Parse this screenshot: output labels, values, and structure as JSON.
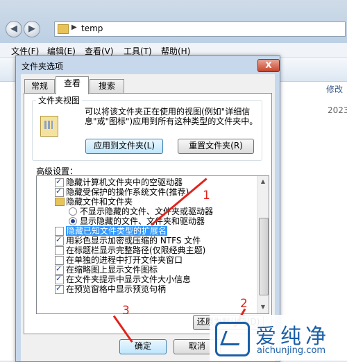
{
  "explorer": {
    "path_label": "temp",
    "menu": [
      "文件(F)",
      "编辑(E)",
      "查看(V)",
      "工具(T)",
      "帮助(H)"
    ],
    "column_header": "修改",
    "column_value": "2023"
  },
  "dialog": {
    "title": "文件夹选项",
    "close_label": "X",
    "tabs": [
      "常规",
      "查看",
      "搜索"
    ],
    "active_tab": "查看",
    "folder_views": {
      "group_label": "文件夹视图",
      "description": "可以将该文件夹正在使用的视图(例如\"详细信息\"或\"图标\")应用到所有这种类型的文件夹中。",
      "apply_button": "应用到文件夹(L)",
      "reset_button": "重置文件夹(R)"
    },
    "advanced": {
      "label": "高级设置：",
      "items": [
        {
          "type": "checkbox",
          "checked": true,
          "label": "隐藏计算机文件夹中的空驱动器"
        },
        {
          "type": "checkbox",
          "checked": true,
          "label": "隐藏受保护的操作系统文件(推荐)"
        },
        {
          "type": "folder",
          "label": "隐藏文件和文件夹"
        },
        {
          "type": "radio",
          "checked": false,
          "label": "不显示隐藏的文件、文件夹或驱动器"
        },
        {
          "type": "radio",
          "checked": true,
          "label": "显示隐藏的文件、文件夹和驱动器"
        },
        {
          "type": "checkbox",
          "checked": false,
          "selected": true,
          "label": "隐藏已知文件类型的扩展名"
        },
        {
          "type": "checkbox",
          "checked": true,
          "label": "用彩色显示加密或压缩的 NTFS 文件"
        },
        {
          "type": "checkbox",
          "checked": false,
          "label": "在标题栏显示完整路径(仅限经典主题)"
        },
        {
          "type": "checkbox",
          "checked": false,
          "label": "在单独的进程中打开文件夹窗口"
        },
        {
          "type": "checkbox",
          "checked": true,
          "label": "在缩略图上显示文件图标"
        },
        {
          "type": "checkbox",
          "checked": true,
          "label": "在文件夹提示中显示文件大小信息"
        },
        {
          "type": "checkbox",
          "checked": true,
          "label": "在预览窗格中显示预览句柄"
        }
      ],
      "restore_button": "还原为默认值(D)"
    },
    "ok_button": "确定",
    "cancel_button": "取消"
  },
  "annotations": [
    "1",
    "2",
    "3"
  ],
  "annotation_color": "#e0231c",
  "watermark": {
    "title": "爱纯净",
    "url": "aichunjing.com"
  }
}
